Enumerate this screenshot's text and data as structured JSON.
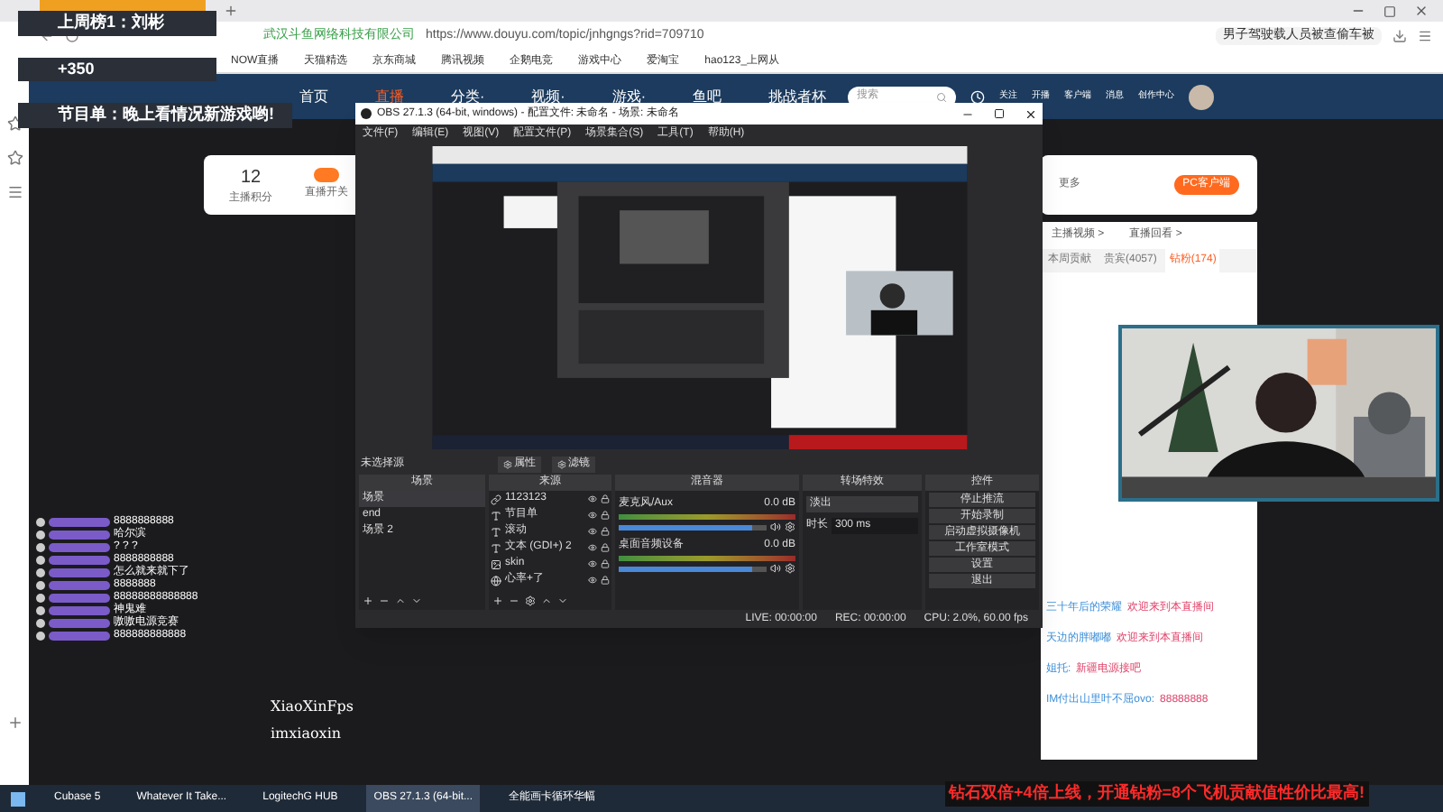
{
  "browser": {
    "site": "武汉斗鱼网络科技有限公司",
    "url": "https://www.douyu.com/topic/jnhgngs?rid=709710",
    "search_hint": "男子驾驶载人员被查偷车被",
    "bookmarks": [
      "NOW直播",
      "天猫精选",
      "京东商城",
      "腾讯视频",
      "企鹅电竞",
      "游戏中心",
      "爱淘宝",
      "hao123_上网从"
    ]
  },
  "site_header": {
    "nav": [
      {
        "label": "首页",
        "selected": false
      },
      {
        "label": "直播",
        "selected": true
      },
      {
        "label": "分类·",
        "selected": false
      },
      {
        "label": "视频·",
        "selected": false
      },
      {
        "label": "游戏·",
        "selected": false
      },
      {
        "label": "鱼吧",
        "selected": false
      },
      {
        "label": "挑战者杯",
        "selected": false
      }
    ],
    "search": {
      "placeholder": "搜索"
    },
    "actions": [
      "关注",
      "开播",
      "客户端",
      "消息",
      "创作中心"
    ]
  },
  "overlay": {
    "top_rank": "上周榜1：刘彬",
    "points": "+350",
    "program": "节目单：晚上看情况新游戏哟!"
  },
  "anchor_card": {
    "score": "12",
    "score_label": "主播积分",
    "switch_label": "直播开关",
    "switch_on": true
  },
  "right_card": {
    "more": "更多",
    "client_button": "PC客户端"
  },
  "obs": {
    "title": "OBS 27.1.3 (64-bit, windows) - 配置文件: 未命名 - 场景: 未命名",
    "menu": [
      "文件(F)",
      "编辑(E)",
      "视图(V)",
      "配置文件(P)",
      "场景集合(S)",
      "工具(T)",
      "帮助(H)"
    ],
    "source_hint": "未选择源",
    "props_button": "属性",
    "filter_button": "滤镜",
    "docks": {
      "scenes": "场景",
      "sources": "来源",
      "mixer": "混音器",
      "transitions": "转场特效",
      "controls": "控件"
    },
    "scenes": [
      {
        "label": "场景",
        "selected": true
      },
      {
        "label": "end",
        "selected": false
      },
      {
        "label": "场景 2",
        "selected": false
      }
    ],
    "sources": [
      {
        "label": "1123123",
        "kind": "link"
      },
      {
        "label": "节目单",
        "kind": "text"
      },
      {
        "label": "滚动",
        "kind": "text"
      },
      {
        "label": "文本 (GDI+) 2",
        "kind": "text"
      },
      {
        "label": "skin"
      },
      {
        "label": "心率+了",
        "kind": "browser"
      }
    ],
    "channels": [
      {
        "name": "麦克风/Aux",
        "reading": "0.0 dB",
        "level": 0.9
      },
      {
        "name": "桌面音频设备",
        "reading": "0.0 dB",
        "level": 0.9
      }
    ],
    "transition": {
      "value": "淡出",
      "duration_label": "时长",
      "duration": "300 ms"
    },
    "controls": [
      "停止推流",
      "开始录制",
      "启动虚拟摄像机",
      "工作室模式",
      "设置",
      "退出"
    ],
    "status": {
      "live": "LIVE: 00:00:00",
      "rec": "REC: 00:00:00",
      "cpu": "CPU: 2.0%, 60.00 fps"
    }
  },
  "danmaku": [
    "8888888888",
    "哈尔滨",
    "? ? ?",
    "8888888888",
    "怎么就来就下了",
    "8888888",
    "88888888888888",
    "神鬼难",
    "嗷嗷电源竞赛",
    "888888888888"
  ],
  "chat": {
    "links": [
      "主播视频 >",
      "直播回看 >"
    ],
    "tabs": [
      {
        "label": "本周贡献",
        "selected": false
      },
      {
        "label": "贵宾(4057)",
        "selected": false
      },
      {
        "label": "钻粉(174)",
        "selected": true
      }
    ],
    "messages": [
      {
        "user": "三十年后的荣耀",
        "text": "欢迎来到本直播间"
      },
      {
        "user": "天边的胖嘟嘟",
        "text": "欢迎来到本直播间"
      },
      {
        "user": "姐托:",
        "text": "新疆电源接吧"
      },
      {
        "user": "IM付出山里叶不屈ovo:",
        "text": "88888888"
      }
    ]
  },
  "social": [
    "XiaoXinFps",
    "imxiaoxin"
  ],
  "banner": "钻石双倍+4倍上线，开通钻粉=8个飞机贡献值性价比最高!",
  "taskbar": [
    {
      "label": "Cubase 5",
      "selected": false
    },
    {
      "label": "Whatever It Take...",
      "selected": false
    },
    {
      "label": "LogitechG HUB",
      "selected": false
    },
    {
      "label": "OBS 27.1.3 (64-bit...",
      "selected": true
    },
    {
      "label": "全能画卡循环华幅",
      "selected": false
    }
  ]
}
